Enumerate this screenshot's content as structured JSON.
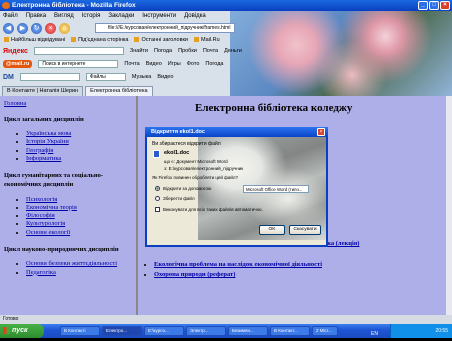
{
  "window": {
    "title": "Електронна бібліотека - Mozilla Firefox"
  },
  "menu": [
    "Файл",
    "Правка",
    "Вигляд",
    "Історія",
    "Закладки",
    "Інструменти",
    "Довідка"
  ],
  "address": {
    "url": "file:///E:/курсовая/електронний_підручник/frames.html"
  },
  "bookmarks": [
    "Найбільш відвідувані",
    "Під'єднана сторінка",
    "Останні заголовки",
    "Mail.Ru"
  ],
  "toolbar1": {
    "logo": "Яндекс",
    "items": [
      "Знайти",
      "Погода",
      "Пробки",
      "Почта",
      "Деньги"
    ]
  },
  "toolbar2": {
    "logo": "@mail.ru",
    "search_placeholder": "Поиск в интернете",
    "items": [
      "Почта",
      "Видео",
      "Игры",
      "Фото",
      "Погода"
    ]
  },
  "toolbar3": {
    "logo": "DM",
    "items": [
      "Файлы",
      "Музыка",
      "Видео"
    ]
  },
  "tabs": [
    "В Контакте | Наталія Шерин",
    "Електронна бібліотека"
  ],
  "sidebar": {
    "home": "Головна",
    "sections": [
      {
        "heading": "Цикл загальних дисциплін",
        "items": [
          "Українська мова",
          "Історія України",
          "Географія",
          "Інформатика"
        ]
      },
      {
        "heading": "Цикл гуманітарних та соціально-економічних дисциплін",
        "items": [
          "Психологія",
          "Економічна теорія",
          "Філософія",
          "Культурологія",
          "Основи екології"
        ]
      },
      {
        "heading": "Цикл науково-природничих дисциплін",
        "items": [
          "Основи безпеки життєдіяльності",
          "Педагогіка"
        ]
      }
    ]
  },
  "main": {
    "title": "Електронна бібліотека коледжу",
    "peek_link": "ука (лекція)",
    "links": [
      "Екологічна проблема на наслідок економічної діяльності",
      "Охорона природи (реферат)"
    ]
  },
  "dialog": {
    "title": "Відкриття ekol1.doc",
    "intro": "Ви збираєтеся відкрити файл",
    "filename": "ekol1.doc",
    "filetype": "що є: Документ Microsoft Word",
    "from": "з: E:\\курсовая\\електронний_підручник",
    "question": "Як Firefox повинен обробляти цей файл?",
    "open_with": "Відкрити за допомогою",
    "app": "Microsoft Office Word (типо...",
    "save": "Зберегти файл",
    "remember": "Виконувати для всіх таких файлів автоматично.",
    "ok": "OK",
    "cancel": "Скасувати"
  },
  "status": "Готово",
  "taskbar": {
    "start": "пуск",
    "tasks": [
      "В Контакті",
      "Електро...",
      "E:\\курсо...",
      "Электр...",
      "Безимян...",
      "В Контакт...",
      "2 Micr..."
    ],
    "lang": "EN",
    "clock": "20:55"
  }
}
